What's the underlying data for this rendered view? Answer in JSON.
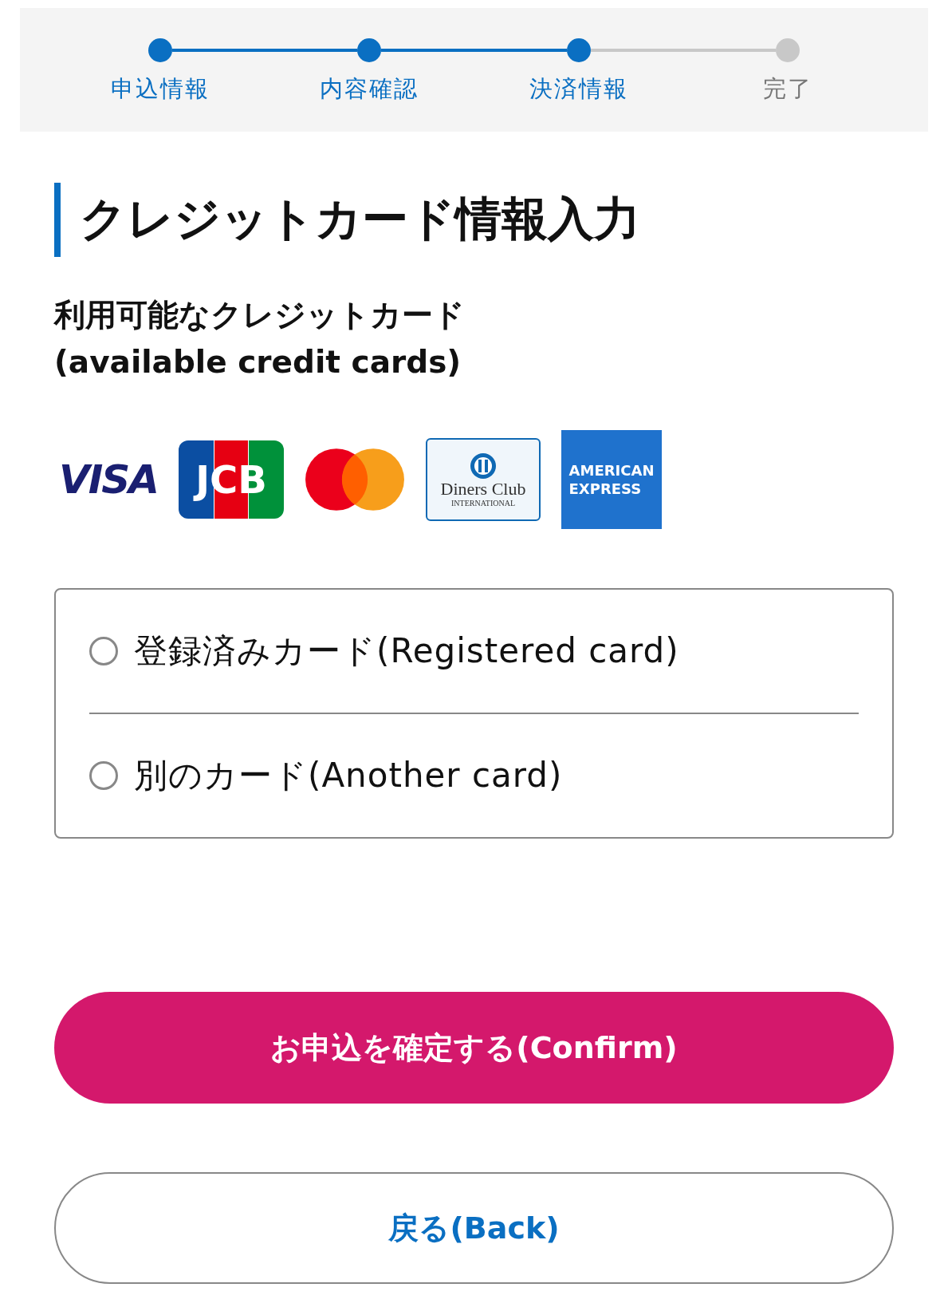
{
  "steps": [
    {
      "label": "申込情報",
      "done": true
    },
    {
      "label": "内容確認",
      "done": true
    },
    {
      "label": "決済情報",
      "done": true
    },
    {
      "label": "完了",
      "done": false
    }
  ],
  "heading": "クレジットカード情報入力",
  "available_label": [
    "利用可能なクレジットカード",
    "(available credit cards)"
  ],
  "cards": [
    {
      "kind": "visa",
      "texts": [
        "VISA"
      ]
    },
    {
      "kind": "jcb",
      "texts": [
        "JCB"
      ]
    },
    {
      "kind": "mastercard"
    },
    {
      "kind": "diners",
      "texts": [
        "Diners Club",
        "INTERNATIONAL"
      ]
    },
    {
      "kind": "amex",
      "texts": [
        "AMERICAN",
        "EXPRESS"
      ]
    }
  ],
  "options": [
    {
      "label": "登録済みカード(Registered card)",
      "selected": false
    },
    {
      "label": "別のカード(Another card)",
      "selected": false
    }
  ],
  "confirm_button": "お申込を確定する(Confirm)",
  "back_button": "戻る(Back)"
}
